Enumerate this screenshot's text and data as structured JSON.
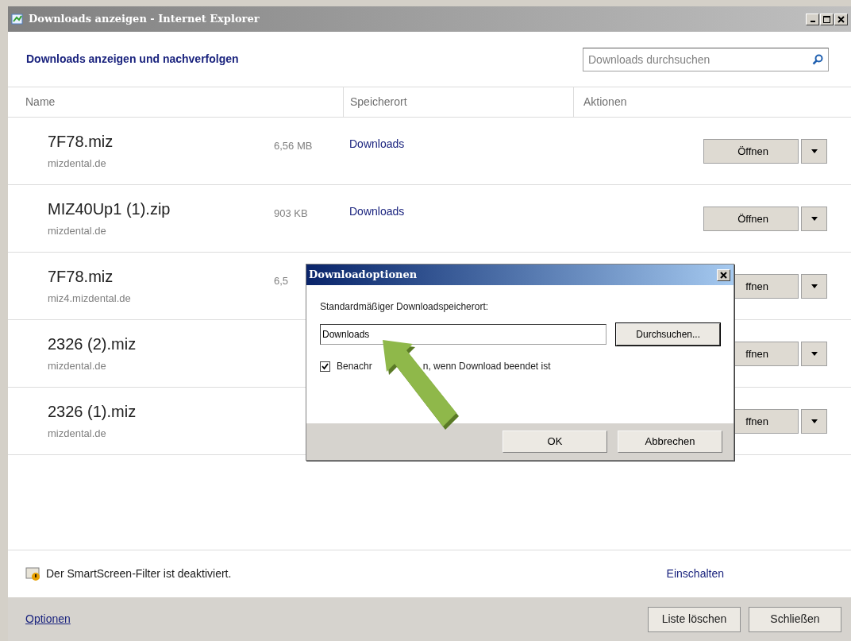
{
  "window": {
    "title": "Downloads anzeigen - Internet Explorer"
  },
  "header": {
    "title": "Downloads anzeigen und nachverfolgen",
    "search": {
      "placeholder": "Downloads durchsuchen"
    }
  },
  "columns": [
    "Name",
    "Speicherort",
    "Aktionen"
  ],
  "downloads": [
    {
      "name": "7F78.miz",
      "source": "mizdental.de",
      "size": "6,56 MB",
      "location": "Downloads",
      "action": "Öffnen"
    },
    {
      "name": "MIZ40Up1 (1).zip",
      "source": "mizdental.de",
      "size": "903 KB",
      "location": "Downloads",
      "action": "Öffnen"
    },
    {
      "name": "7F78.miz",
      "source": "miz4.mizdental.de",
      "size": "6,5",
      "action": "ffnen"
    },
    {
      "name": "2326 (2).miz",
      "source": "mizdental.de",
      "action": "ffnen"
    },
    {
      "name": "2326 (1).miz",
      "source": "mizdental.de",
      "action": "ffnen"
    }
  ],
  "smartscreen": {
    "message": "Der SmartScreen-Filter ist deaktiviert.",
    "link": "Einschalten"
  },
  "footer": {
    "link": "Optionen",
    "buttons": [
      "Liste löschen",
      "Schließen"
    ]
  },
  "dialog": {
    "title": "Downloadoptionen",
    "label": "Standardmäßiger Downloadspeicherort:",
    "value": "Downloads",
    "browse": "Durchsuchen...",
    "checkbox": {
      "label_parts": [
        "Benachr",
        "n, wenn Download beendet ist"
      ],
      "checked": true
    },
    "buttons": [
      "OK",
      "Abbrechen"
    ]
  }
}
